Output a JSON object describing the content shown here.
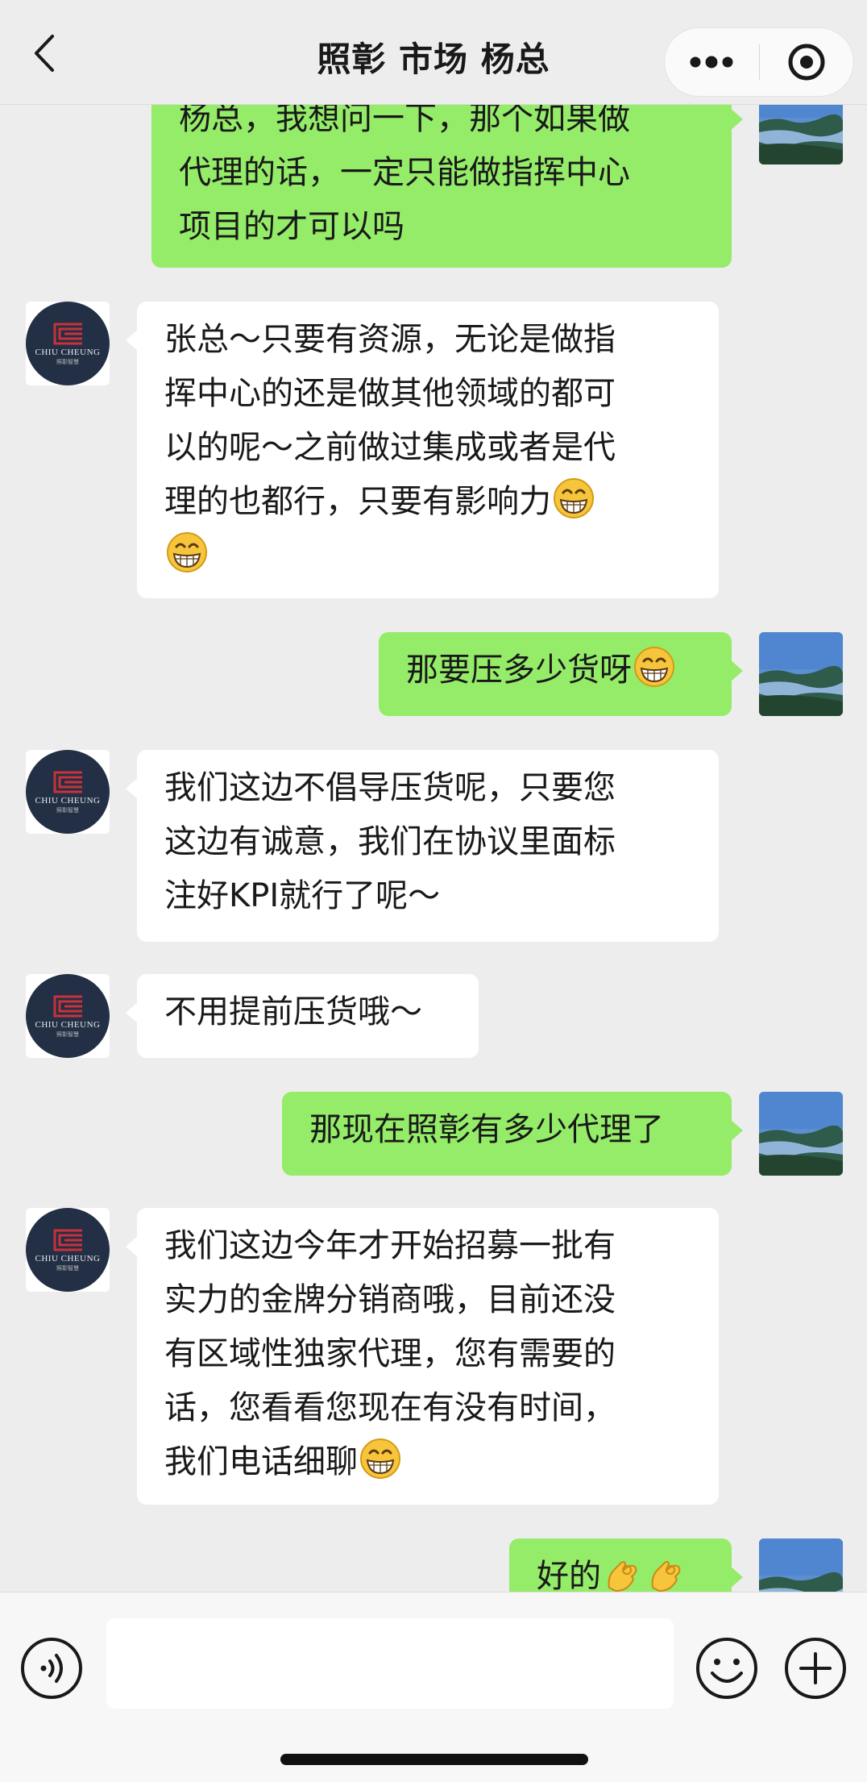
{
  "header": {
    "title": "照彰 市场 杨总"
  },
  "messages": [
    {
      "side": "right",
      "lines": [
        "杨总，我想问一下，那个如果做",
        "代理的话，一定只能做指挥中心",
        "项目的才可以吗"
      ]
    },
    {
      "side": "left",
      "lines": [
        "张总～只要有资源，无论是做指",
        "挥中心的还是做其他领域的都可",
        "以的呢～之前做过集成或者是代",
        "理的也都行，只要有影响力"
      ],
      "emoji": "grin-emoji"
    },
    {
      "side": "right",
      "text": "那要压多少货呀",
      "emoji": "grin-emoji"
    },
    {
      "side": "left",
      "lines": [
        "我们这边不倡导压货呢，只要您",
        "这边有诚意，我们在协议里面标",
        "注好KPI就行了呢～"
      ]
    },
    {
      "side": "left",
      "text": "不用提前压货哦～"
    },
    {
      "side": "right",
      "text": "那现在照彰有多少代理了"
    },
    {
      "side": "left",
      "lines": [
        "我们这边今年才开始招募一批有",
        "实力的金牌分销商哦，目前还没",
        "有区域性独家代理，您有需要的",
        "话，您看看您现在有没有时间，",
        "我们电话细聊"
      ],
      "emoji": "grin-emoji"
    },
    {
      "side": "right",
      "text": "好的",
      "emoji": "ok-hand-emoji"
    }
  ],
  "contact_avatar": {
    "logo_text": "CHIU CHEUNG",
    "logo_sub": "照彰智慧"
  },
  "input": {
    "value": ""
  },
  "colors": {
    "page_bg": "#ededed",
    "sent_bubble": "#95ec69",
    "received_bubble": "#ffffff",
    "brand_avatar": "#232f45",
    "brand_red": "#c8323a"
  }
}
